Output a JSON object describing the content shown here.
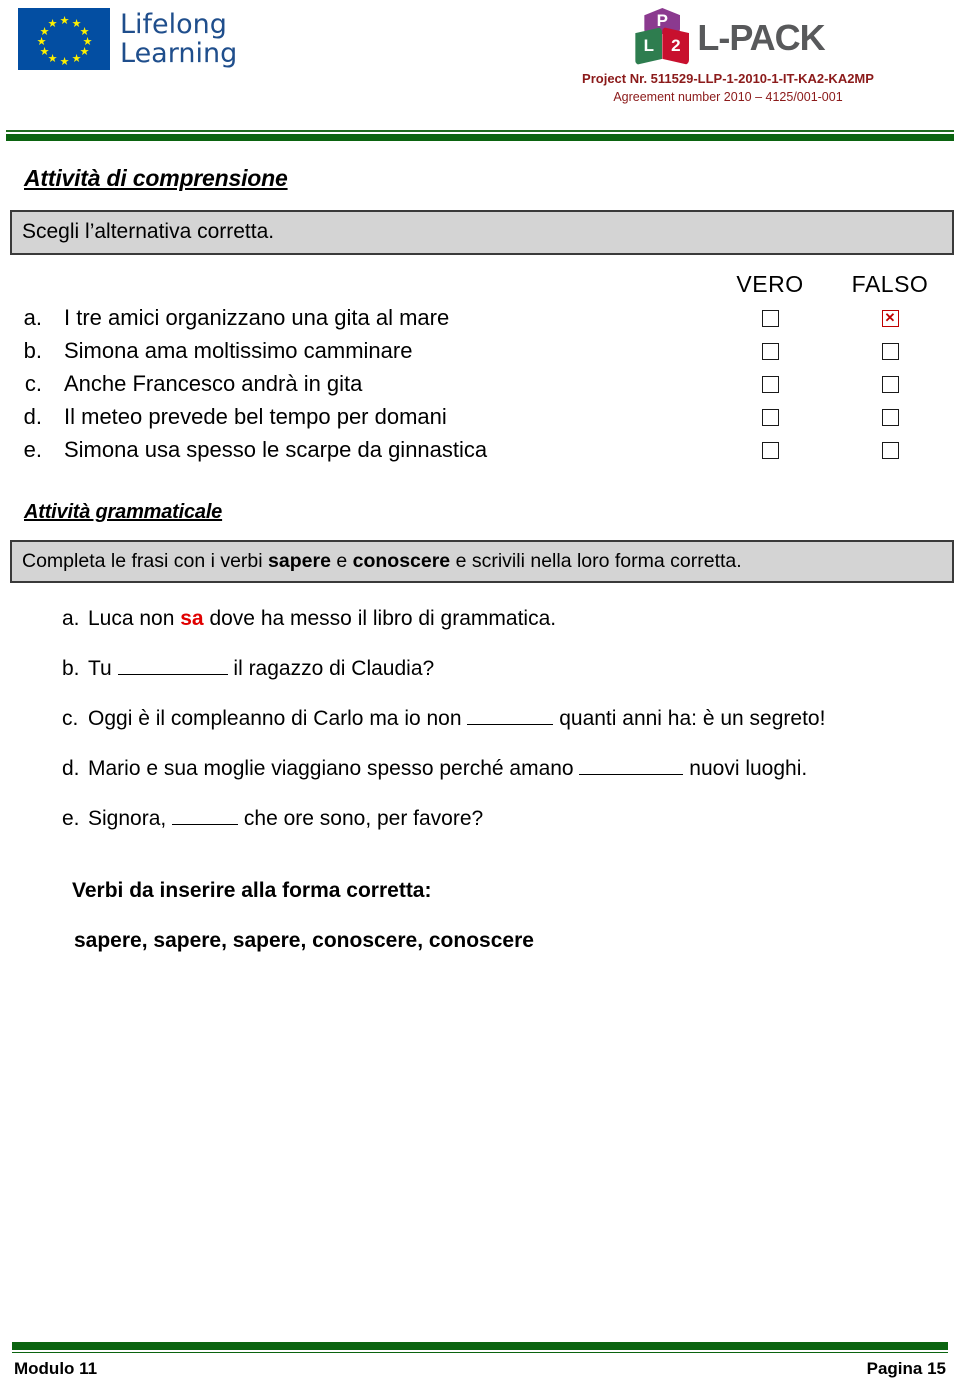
{
  "header": {
    "eu_logo_alt": "Lifelong Learning",
    "eu_logo_line1": "Lifelong",
    "eu_logo_line2": "Learning",
    "lpack_cube_top": "P",
    "lpack_cube_left": "L",
    "lpack_cube_right": "2",
    "lpack_word": "L-PACK",
    "project_number": "Project Nr. 511529-LLP-1-2010-1-IT-KA2-KA2MP",
    "agreement_number": "Agreement number 2010 – 4125/001-001",
    "accent_green": "#0B6410",
    "project_text_color": "#8B1A1A"
  },
  "comprehension": {
    "title": "Attività di comprensione",
    "instruction": "Scegli l’alternativa corretta.",
    "col_true": "VERO",
    "col_false": "FALSO",
    "items": [
      {
        "letter": "a.",
        "text": "I tre amici organizzano una gita al mare",
        "vero": false,
        "falso": true
      },
      {
        "letter": "b.",
        "text": "Simona ama moltissimo camminare",
        "vero": false,
        "falso": false
      },
      {
        "letter": "c.",
        "text": "Anche Francesco andrà in gita",
        "vero": false,
        "falso": false
      },
      {
        "letter": "d.",
        "text": "Il meteo prevede bel tempo per domani",
        "vero": false,
        "falso": false
      },
      {
        "letter": "e.",
        "text": "Simona usa spesso le scarpe da ginnastica",
        "vero": false,
        "falso": false
      }
    ]
  },
  "grammar": {
    "title": "Attività grammaticale",
    "instruction_part1": "Completa le frasi con i verbi ",
    "instruction_bold1": "sapere",
    "instruction_part2": " e ",
    "instruction_bold2": "conoscere",
    "instruction_part3": " e scrivili nella loro forma corretta.",
    "items": [
      {
        "letter": "a.",
        "pre": "Luca non ",
        "answer": "sa",
        "post": " dove ha messo il libro di grammatica.",
        "blank": false
      },
      {
        "letter": "b.",
        "pre": "Tu ",
        "answer": "",
        "post": " il ragazzo di Claudia?",
        "blank": true
      },
      {
        "letter": "c.",
        "pre": "Oggi è il compleanno di Carlo ma io non ",
        "answer": "",
        "post": " quanti anni ha: è un segreto!",
        "blank": true
      },
      {
        "letter": "d.",
        "pre": "Mario e sua moglie viaggiano spesso perché amano ",
        "answer": "",
        "post": " nuovi luoghi.",
        "blank": true
      },
      {
        "letter": "e.",
        "pre": "Signora, ",
        "answer": "",
        "post": " che ore sono, per favore?",
        "blank": true
      }
    ],
    "verbs_title": "Verbi da inserire alla forma corretta:",
    "verbs_list": "sapere, sapere, sapere, conoscere, conoscere"
  },
  "footer": {
    "module": "Modulo 11",
    "page": "Pagina 15"
  }
}
